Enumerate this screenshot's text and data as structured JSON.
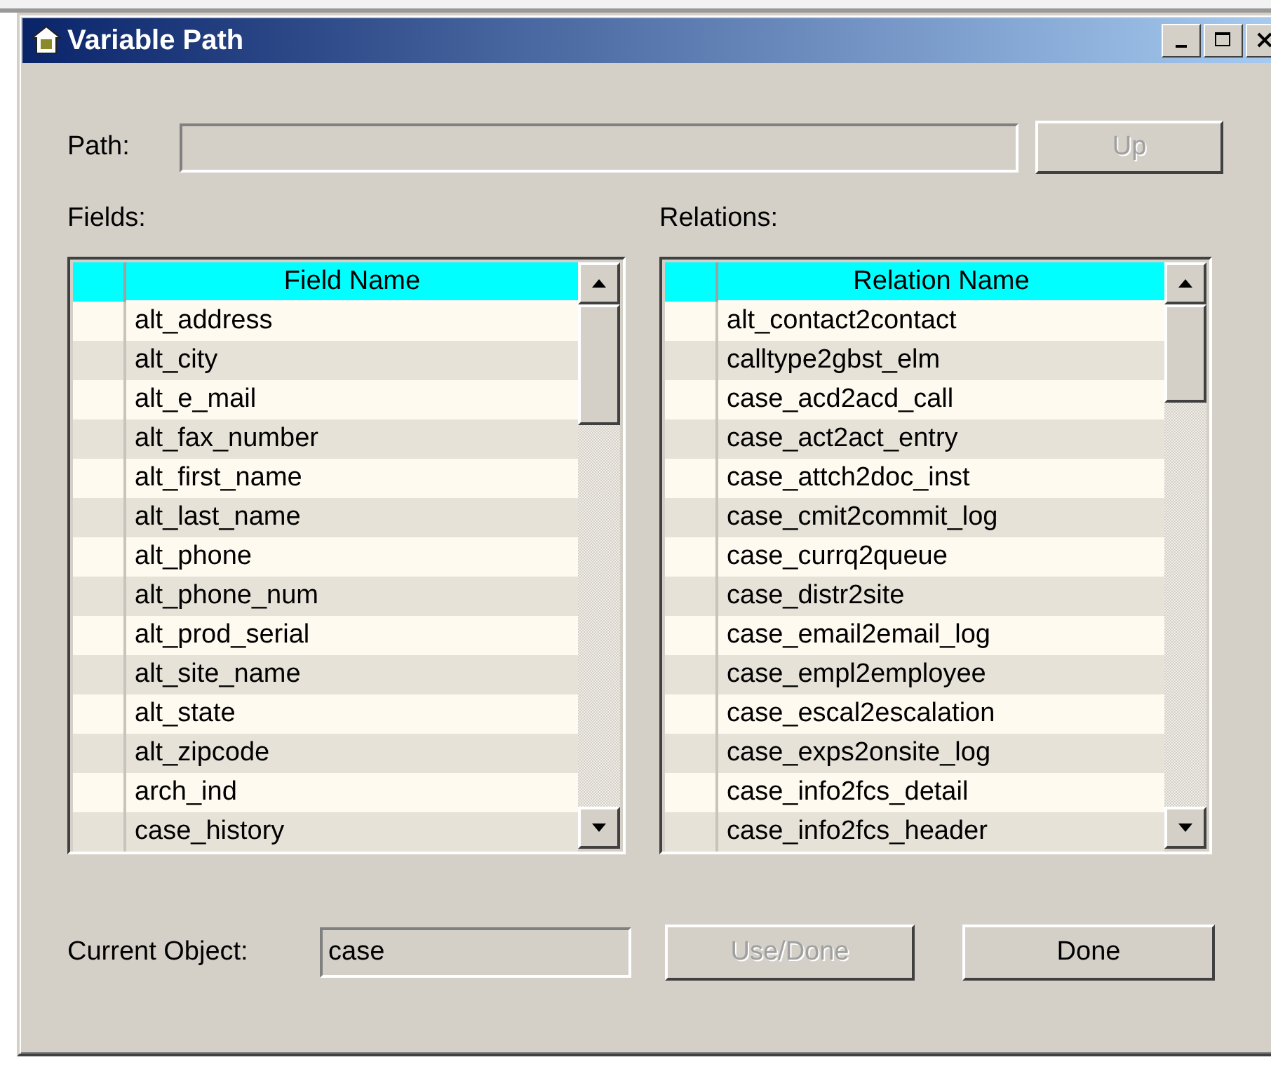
{
  "window": {
    "title": "Variable Path"
  },
  "path": {
    "label": "Path:",
    "disabled": true
  },
  "up_button": {
    "label": "Up",
    "disabled": true
  },
  "lists": [
    {
      "label": "Fields:",
      "column": "Field Name",
      "rows": [
        "alt_address",
        "alt_city",
        "alt_e_mail",
        "alt_fax_number",
        "alt_first_name",
        "alt_last_name",
        "alt_phone",
        "alt_phone_num",
        "alt_prod_serial",
        "alt_site_name",
        "alt_state",
        "alt_zipcode",
        "arch_ind",
        "case_history"
      ]
    },
    {
      "label": "Relations:",
      "column": "Relation Name",
      "rows": [
        "alt_contact2contact",
        "calltype2gbst_elm",
        "case_acd2acd_call",
        "case_act2act_entry",
        "case_attch2doc_inst",
        "case_cmit2commit_log",
        "case_currq2queue",
        "case_distr2site",
        "case_email2email_log",
        "case_empl2employee",
        "case_escal2escalation",
        "case_exps2onsite_log",
        "case_info2fcs_detail",
        "case_info2fcs_header"
      ]
    }
  ],
  "current_object": {
    "label": "Current Object:",
    "value": "case"
  },
  "buttons": [
    {
      "label": "Use/Done",
      "disabled": true
    },
    {
      "label": "Done",
      "disabled": false
    }
  ]
}
